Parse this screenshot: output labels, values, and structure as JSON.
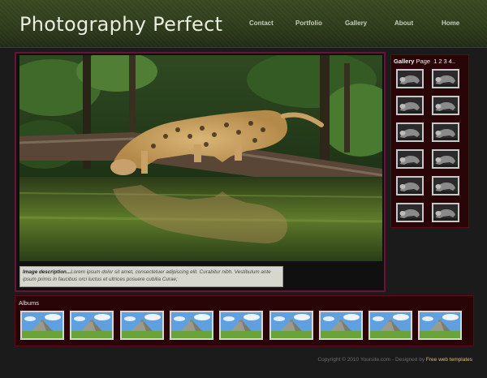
{
  "header": {
    "title": "Photography Perfect"
  },
  "nav": [
    {
      "label": "Contact"
    },
    {
      "label": "Portfolio"
    },
    {
      "label": "Gallery"
    },
    {
      "label": "About"
    },
    {
      "label": "Home"
    }
  ],
  "caption": {
    "label": "Image description...",
    "text": "Lorem ipsum dolor sit amet, consectetuer adipiscing elit. Curabitur nibh. Vestibulum ante ipsum primis in faucibus orci luctus et ultrices posuere cubilia Curae;"
  },
  "gallery": {
    "label": "Gallery",
    "page_word": "Page",
    "pages": [
      "1",
      "2",
      "3",
      "4.."
    ]
  },
  "albums": {
    "label": "Albums"
  },
  "footer": {
    "copyright": "Copyright © 2010 Yoursite.com - Designed by",
    "link": "Free web templates"
  }
}
